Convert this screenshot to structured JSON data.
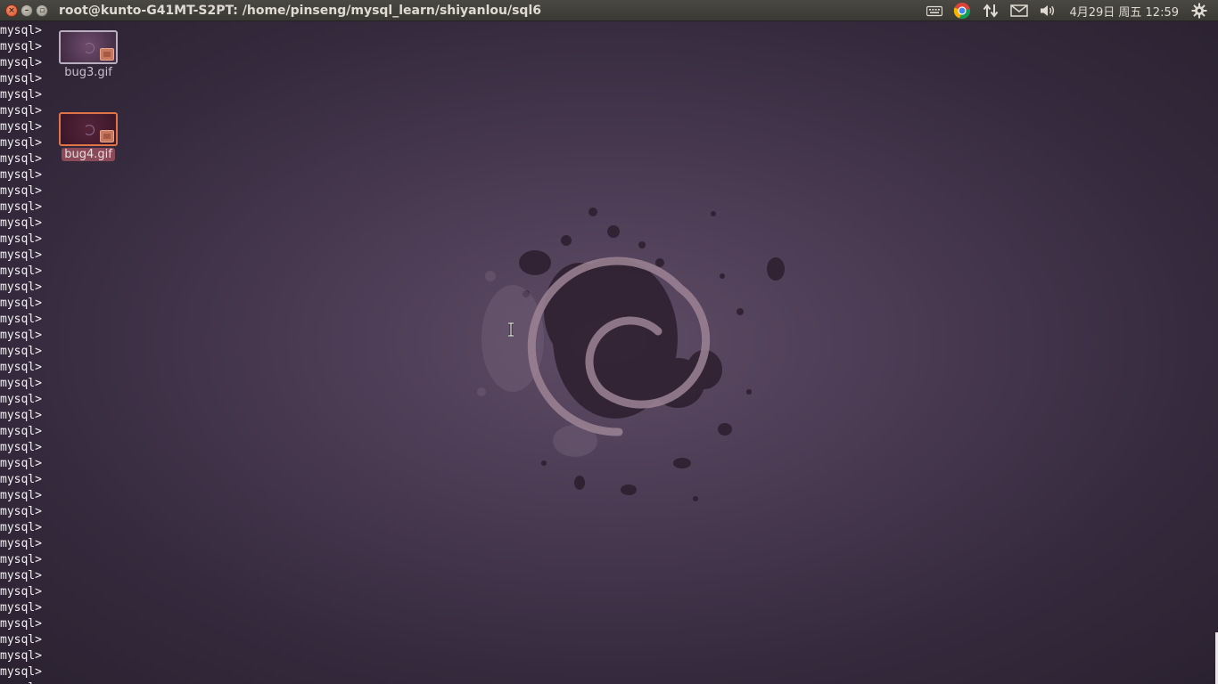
{
  "panel": {
    "window_title": "root@kunto-G41MT-S2PT: /home/pinseng/mysql_learn/shiyanlou/sql6",
    "window_controls": {
      "close_icon": "close-icon",
      "minimize_icon": "minimize-icon",
      "maximize_icon": "maximize-icon"
    },
    "indicators": {
      "keyboard_icon": "keyboard-icon",
      "chrome_icon": "chrome-icon",
      "network_icon": "network-updown-icon",
      "mail_icon": "mail-icon",
      "volume_icon": "volume-icon",
      "gear_icon": "gear-icon"
    },
    "clock": "4月29日 周五 12:59"
  },
  "terminal": {
    "prompt": "mysql>",
    "lines": [
      "mysql>",
      "mysql>",
      "mysql>",
      "mysql>",
      "mysql>",
      "mysql>",
      "mysql>",
      "mysql>",
      "mysql>",
      "mysql>",
      "mysql>",
      "mysql>",
      "mysql>",
      "mysql>",
      "mysql>",
      "mysql>",
      "mysql>",
      "mysql>",
      "mysql>",
      "mysql>",
      "mysql>",
      "mysql>",
      "mysql>",
      "mysql>",
      "mysql>",
      "mysql>",
      "mysql>",
      "mysql>",
      "mysql>",
      "mysql>",
      "mysql>",
      "mysql>",
      "mysql>",
      "mysql>",
      "mysql>",
      "mysql>",
      "mysql>",
      "mysql>",
      "mysql>",
      "mysql>",
      "mysql>",
      "mysql>"
    ]
  },
  "desktop": {
    "icons": [
      {
        "label": "bug3.gif",
        "selected": false
      },
      {
        "label": "bug4.gif",
        "selected": true
      }
    ]
  },
  "colors": {
    "panel_bg": "#3c3b37",
    "panel_text": "#dfdbd2",
    "close_button": "#e0643a",
    "wallpaper_center": "#5f4c66",
    "wallpaper_edge": "#2a2130",
    "selected_border": "#e07448",
    "selected_label_bg": "#8a4a58"
  }
}
